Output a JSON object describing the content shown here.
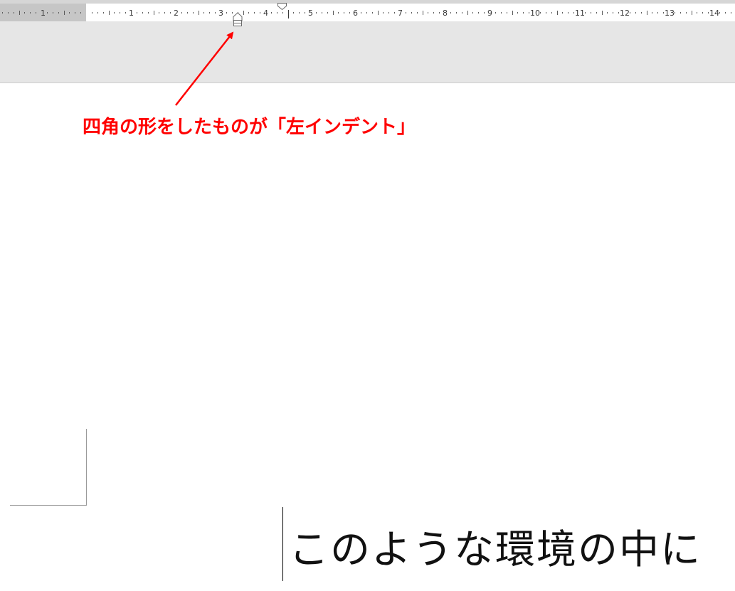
{
  "ruler": {
    "left_margin_label": "1",
    "numbers": [
      "1",
      "2",
      "3",
      "4",
      "5",
      "6",
      "7",
      "8",
      "9",
      "10",
      "11",
      "12",
      "13",
      "14"
    ]
  },
  "annotation": {
    "text": "四角の形をしたものが「左インデント」",
    "color": "#ff0000"
  },
  "document": {
    "body_text": "このような環境の中に"
  },
  "colors": {
    "ruler_margin": "#c6c6c6",
    "ribbon_background": "#e6e6e6",
    "annotation_red": "#ff0000"
  },
  "icons": {
    "first_line_indent": "first-line-indent-marker-icon",
    "left_indent": "left-indent-marker-icon"
  }
}
